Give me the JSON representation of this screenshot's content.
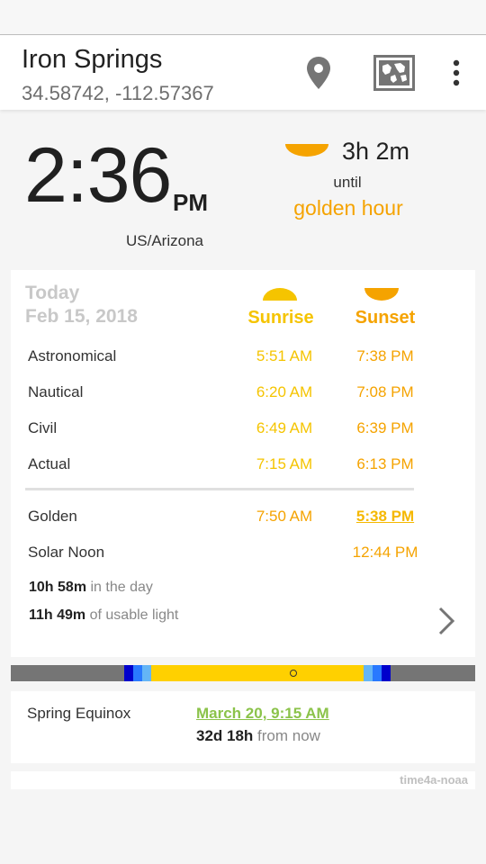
{
  "header": {
    "location_name": "Iron Springs",
    "coordinates": "34.58742, -112.57367",
    "icons": [
      "location-pin-icon",
      "world-map-icon",
      "more-vert-icon"
    ]
  },
  "clock": {
    "time": "2:36",
    "ampm": "PM",
    "timezone": "US/Arizona"
  },
  "golden_hour": {
    "countdown": "3h 2m",
    "until": "until",
    "label": "golden hour"
  },
  "card": {
    "today": "Today",
    "date": "Feb 15, 2018",
    "sunrise_header": "Sunrise",
    "sunset_header": "Sunset",
    "rows": [
      {
        "label": "Astronomical",
        "sunrise": "5:51 AM",
        "sunset": "7:38 PM"
      },
      {
        "label": "Nautical",
        "sunrise": "6:20 AM",
        "sunset": "7:08 PM"
      },
      {
        "label": "Civil",
        "sunrise": "6:49 AM",
        "sunset": "6:39 PM"
      },
      {
        "label": "Actual",
        "sunrise": "7:15 AM",
        "sunset": "6:13 PM"
      }
    ],
    "golden": {
      "label": "Golden",
      "sunrise": "7:50 AM",
      "sunset": "5:38 PM"
    },
    "solar_noon": {
      "label": "Solar Noon",
      "value": "12:44 PM"
    },
    "day_length": {
      "value": "10h 58m",
      "suffix": " in the day"
    },
    "usable_light": {
      "value": "11h 49m",
      "suffix": " of usable light"
    }
  },
  "equinox": {
    "label": "Spring Equinox",
    "date": "March 20, 9:15 AM",
    "relative": "32d 18h",
    "relative_suffix": " from now"
  },
  "footer": {
    "source": "time4a-noaa"
  },
  "colors": {
    "sunrise": "#f5c400",
    "sunset": "#f5a300",
    "equinox_link": "#8bc34a",
    "night": "#757575",
    "astronomical": "#0000cc",
    "nautical": "#2979ff",
    "civil": "#64b5f6",
    "day": "#ffd000"
  }
}
